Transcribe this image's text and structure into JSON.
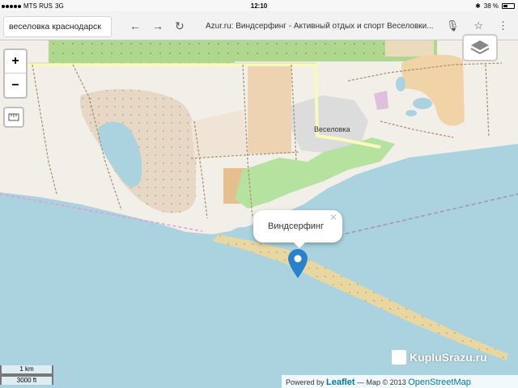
{
  "status_bar": {
    "carrier": "MTS RUS",
    "network": "3G",
    "time": "12:10",
    "battery": "38 %"
  },
  "browser": {
    "search_text": "веселовка краснодарск",
    "page_title": "Azur.ru: Виндсерфинг - Активный отдых и спорт Веселовки..."
  },
  "map": {
    "place_label": "Веселовка",
    "popup_text": "Виндсерфинг",
    "zoom_in_label": "+",
    "zoom_out_label": "−",
    "scale_km": "1 km",
    "scale_ft": "3000 ft",
    "attribution": {
      "powered_by": "Powered by",
      "leaflet": "Leaflet",
      "map_prefix": "— Map © 2013",
      "osm": "OpenStreetMap"
    },
    "marker_color": "#2a81cb",
    "water_color": "#aad3df",
    "land_color": "#f2efe9"
  },
  "watermark": {
    "text": "KupluSrazu.ru"
  }
}
